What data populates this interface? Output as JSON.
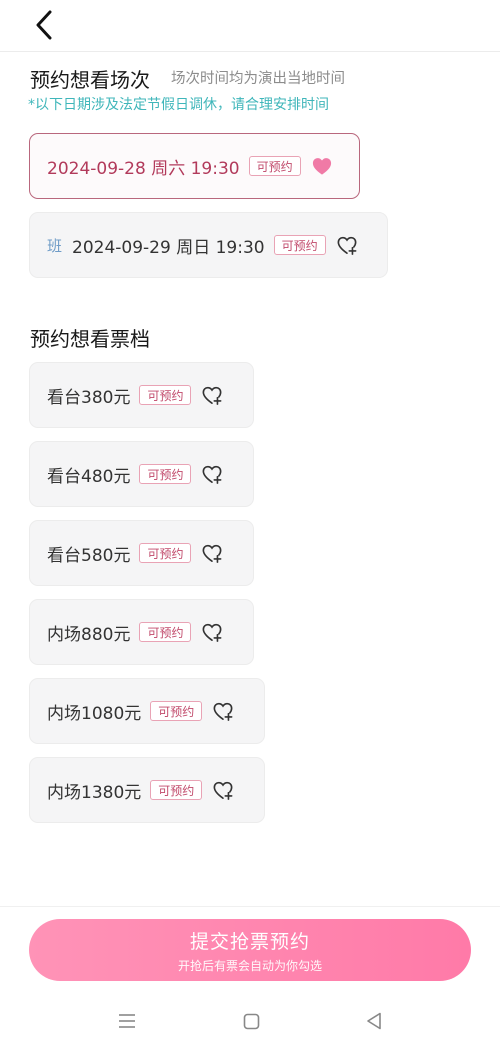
{
  "header": {
    "back_icon": "chevron-left-icon"
  },
  "sessions": {
    "title": "预约想看场次",
    "subtitle": "场次时间均为演出当地时间",
    "notice": "*以下日期涉及法定节假日调休，请合理安排时间",
    "items": [
      {
        "text": "2024-09-28 周六 19:30",
        "badge": "可预约",
        "tag": "",
        "selected": true
      },
      {
        "text": "2024-09-29 周日 19:30",
        "badge": "可预约",
        "tag": "班",
        "selected": false
      }
    ]
  },
  "tickets": {
    "title": "预约想看票档",
    "items": [
      {
        "text": "看台380元",
        "badge": "可预约"
      },
      {
        "text": "看台480元",
        "badge": "可预约"
      },
      {
        "text": "看台580元",
        "badge": "可预约"
      },
      {
        "text": "内场880元",
        "badge": "可预约"
      },
      {
        "text": "内场1080元",
        "badge": "可预约"
      },
      {
        "text": "内场1380元",
        "badge": "可预约"
      }
    ]
  },
  "submit": {
    "label": "提交抢票预约",
    "sub": "开抢后有票会自动为你勾选"
  },
  "colors": {
    "accent": "#ff7aa8",
    "selected_border": "#b9677d",
    "badge_text": "#c14a6b",
    "notice": "#3fb6ba"
  },
  "nav": {
    "icons": [
      "menu-icon",
      "home-square-icon",
      "back-triangle-icon"
    ]
  }
}
